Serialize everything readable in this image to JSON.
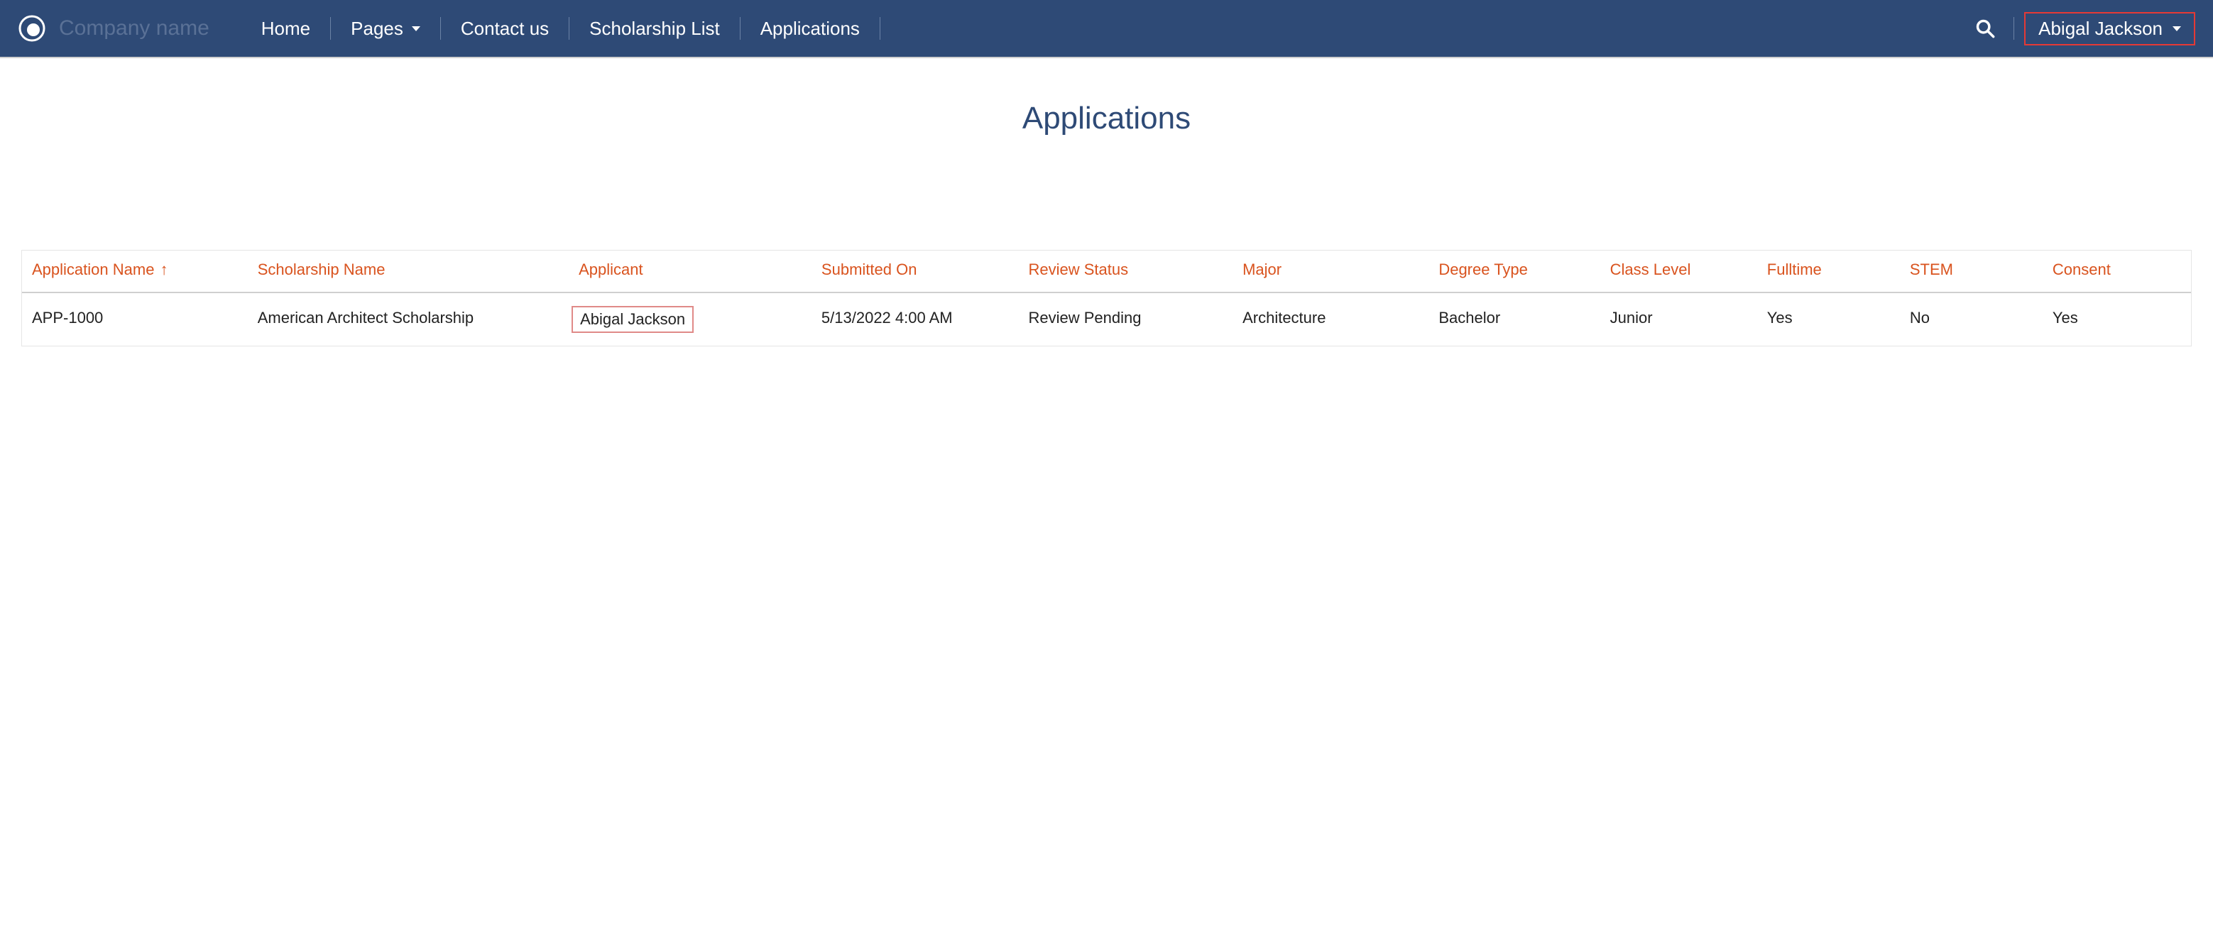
{
  "brand": {
    "company_name": "Company name"
  },
  "nav": {
    "home": "Home",
    "pages": "Pages",
    "contact": "Contact us",
    "scholarship_list": "Scholarship List",
    "applications": "Applications",
    "user_name": "Abigal Jackson"
  },
  "page": {
    "title": "Applications"
  },
  "table": {
    "headers": {
      "application_name": "Application Name",
      "scholarship_name": "Scholarship Name",
      "applicant": "Applicant",
      "submitted_on": "Submitted On",
      "review_status": "Review Status",
      "major": "Major",
      "degree_type": "Degree Type",
      "class_level": "Class Level",
      "fulltime": "Fulltime",
      "stem": "STEM",
      "consent": "Consent"
    },
    "sort_indicator": "↑",
    "rows": [
      {
        "application_name": "APP-1000",
        "scholarship_name": "American Architect Scholarship",
        "applicant": "Abigal Jackson",
        "submitted_on": "5/13/2022 4:00 AM",
        "review_status": "Review Pending",
        "major": "Architecture",
        "degree_type": "Bachelor",
        "class_level": "Junior",
        "fulltime": "Yes",
        "stem": "No",
        "consent": "Yes"
      }
    ]
  }
}
